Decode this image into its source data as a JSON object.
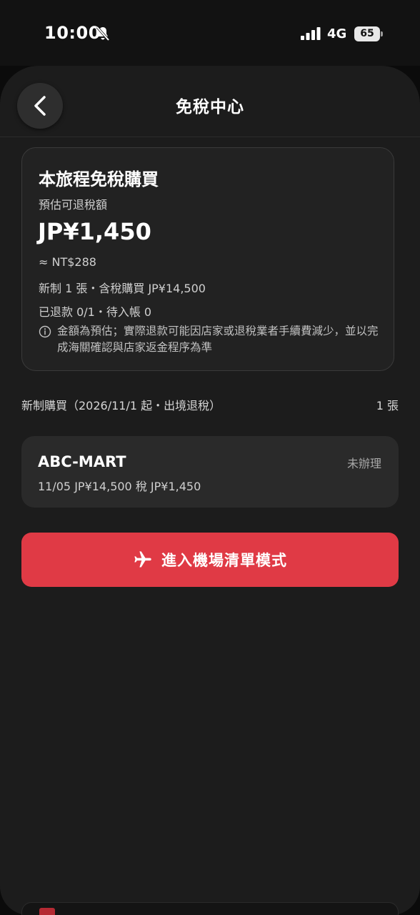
{
  "status": {
    "time": "10:00",
    "network": "4G",
    "battery": "65"
  },
  "header": {
    "title": "免稅中心"
  },
  "summary": {
    "title": "本旅程免稅購買",
    "refund_label": "預估可退稅額",
    "refund_amount": "JP¥1,450",
    "refund_ntd": "≈ NT$288",
    "new_count": "新制 1 張・含稅購買 JP¥14,500",
    "refunded": "已退款 0/1・待入帳 0",
    "disclaimer": "金額為預估；實際退款可能因店家或退稅業者手續費減少，並以完成海關確認與店家返金程序為準"
  },
  "section": {
    "label": "新制購買（2026/11/1 起・出境退稅）",
    "count": "1 張"
  },
  "items": [
    {
      "store": "ABC-MART",
      "detail": "11/05 JP¥14,500 稅 JP¥1,450",
      "status": "未辦理"
    }
  ],
  "airport_button": {
    "label": "進入機場清單模式",
    "icon": "airplane-icon",
    "color": "#e03a45"
  }
}
